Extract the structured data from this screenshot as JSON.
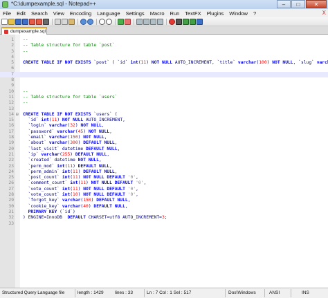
{
  "window": {
    "title": "*C:\\dumpexample.sql - Notepad++",
    "min": "–",
    "max": "□",
    "close": "✕"
  },
  "menu": [
    "File",
    "Edit",
    "Search",
    "View",
    "Encoding",
    "Language",
    "Settings",
    "Macro",
    "Run",
    "TextFX",
    "Plugins",
    "Window",
    "?"
  ],
  "menu_close": "X",
  "tab": {
    "label": "dumpexample.sql"
  },
  "editor": {
    "lines": [
      {
        "n": "1",
        "fold": "",
        "segs": [
          {
            "c": "cmt",
            "t": "--"
          }
        ]
      },
      {
        "n": "2",
        "fold": "",
        "segs": [
          {
            "c": "cmt",
            "t": "-- Table structure for table `post`"
          }
        ]
      },
      {
        "n": "3",
        "fold": "",
        "segs": [
          {
            "c": "cmt",
            "t": "--"
          }
        ]
      },
      {
        "n": "4",
        "fold": "",
        "segs": []
      },
      {
        "n": "5",
        "fold": "",
        "segs": [
          {
            "c": "kw",
            "t": "CREATE TABLE IF NOT EXISTS "
          },
          {
            "c": "tx",
            "t": "`post` ( `id` "
          },
          {
            "c": "kw",
            "t": "int"
          },
          {
            "c": "tx",
            "t": "("
          },
          {
            "c": "num",
            "t": "11"
          },
          {
            "c": "tx",
            "t": ") "
          },
          {
            "c": "kw",
            "t": "NOT NULL"
          },
          {
            "c": "tx",
            "t": " AUTO_INCREMENT, `title` "
          },
          {
            "c": "kw",
            "t": "varchar"
          },
          {
            "c": "tx",
            "t": "("
          },
          {
            "c": "num",
            "t": "100"
          },
          {
            "c": "tx",
            "t": ") "
          },
          {
            "c": "kw",
            "t": "NOT NULL"
          },
          {
            "c": "tx",
            "t": ", `slug` "
          },
          {
            "c": "kw",
            "t": "varchar"
          },
          {
            "c": "tx",
            "t": "("
          },
          {
            "c": "num",
            "t": "2"
          }
        ]
      },
      {
        "n": "6",
        "fold": "",
        "segs": []
      },
      {
        "n": "7",
        "fold": "",
        "segs": [],
        "current": true
      },
      {
        "n": "8",
        "fold": "",
        "segs": []
      },
      {
        "n": "9",
        "fold": "",
        "segs": []
      },
      {
        "n": "10",
        "fold": "",
        "segs": [
          {
            "c": "cmt",
            "t": "--"
          }
        ]
      },
      {
        "n": "11",
        "fold": "",
        "segs": [
          {
            "c": "cmt",
            "t": "-- Table structure for table `users`"
          }
        ]
      },
      {
        "n": "12",
        "fold": "",
        "segs": [
          {
            "c": "cmt",
            "t": "--"
          }
        ]
      },
      {
        "n": "13",
        "fold": "",
        "segs": []
      },
      {
        "n": "14",
        "fold": "⊟",
        "segs": [
          {
            "c": "kw",
            "t": "CREATE TABLE IF NOT EXISTS "
          },
          {
            "c": "tx",
            "t": "`users` ("
          }
        ]
      },
      {
        "n": "15",
        "fold": "",
        "segs": [
          {
            "c": "tx",
            "t": "  `id` "
          },
          {
            "c": "kw",
            "t": "int"
          },
          {
            "c": "tx",
            "t": "("
          },
          {
            "c": "num",
            "t": "11"
          },
          {
            "c": "tx",
            "t": ") "
          },
          {
            "c": "kw",
            "t": "NOT NULL"
          },
          {
            "c": "tx",
            "t": " AUTO_INCREMENT,"
          }
        ]
      },
      {
        "n": "16",
        "fold": "",
        "segs": [
          {
            "c": "tx",
            "t": "  `login` "
          },
          {
            "c": "kw",
            "t": "varchar"
          },
          {
            "c": "tx",
            "t": "("
          },
          {
            "c": "num",
            "t": "32"
          },
          {
            "c": "tx",
            "t": ") "
          },
          {
            "c": "kw",
            "t": "NOT NULL"
          },
          {
            "c": "tx",
            "t": ","
          }
        ]
      },
      {
        "n": "17",
        "fold": "",
        "segs": [
          {
            "c": "tx",
            "t": "  `password` "
          },
          {
            "c": "kw",
            "t": "varchar"
          },
          {
            "c": "tx",
            "t": "("
          },
          {
            "c": "num",
            "t": "45"
          },
          {
            "c": "tx",
            "t": ") "
          },
          {
            "c": "kw",
            "t": "NOT NULL"
          },
          {
            "c": "tx",
            "t": ","
          }
        ]
      },
      {
        "n": "18",
        "fold": "",
        "segs": [
          {
            "c": "tx",
            "t": "  `email` "
          },
          {
            "c": "kw",
            "t": "varchar"
          },
          {
            "c": "tx",
            "t": "("
          },
          {
            "c": "num",
            "t": "150"
          },
          {
            "c": "tx",
            "t": ") "
          },
          {
            "c": "kw",
            "t": "NOT NULL"
          },
          {
            "c": "tx",
            "t": ","
          }
        ]
      },
      {
        "n": "19",
        "fold": "",
        "segs": [
          {
            "c": "tx",
            "t": "  `about` "
          },
          {
            "c": "kw",
            "t": "varchar"
          },
          {
            "c": "tx",
            "t": "("
          },
          {
            "c": "num",
            "t": "300"
          },
          {
            "c": "tx",
            "t": ") "
          },
          {
            "c": "kw",
            "t": "DEFAULT NULL"
          },
          {
            "c": "tx",
            "t": ","
          }
        ]
      },
      {
        "n": "20",
        "fold": "",
        "segs": [
          {
            "c": "tx",
            "t": "  `last_visit` datetime "
          },
          {
            "c": "kw",
            "t": "DEFAULT NULL"
          },
          {
            "c": "tx",
            "t": ","
          }
        ]
      },
      {
        "n": "21",
        "fold": "",
        "segs": [
          {
            "c": "tx",
            "t": "  `ip` "
          },
          {
            "c": "kw",
            "t": "varchar"
          },
          {
            "c": "tx",
            "t": "("
          },
          {
            "c": "num",
            "t": "255"
          },
          {
            "c": "tx",
            "t": ") "
          },
          {
            "c": "kw",
            "t": "DEFAULT NULL"
          },
          {
            "c": "tx",
            "t": ","
          }
        ]
      },
      {
        "n": "22",
        "fold": "",
        "segs": [
          {
            "c": "tx",
            "t": "  `created` datetime "
          },
          {
            "c": "kw",
            "t": "NOT NULL"
          },
          {
            "c": "tx",
            "t": ","
          }
        ]
      },
      {
        "n": "23",
        "fold": "",
        "segs": [
          {
            "c": "tx",
            "t": "  `perm_mod` "
          },
          {
            "c": "kw",
            "t": "int"
          },
          {
            "c": "tx",
            "t": "("
          },
          {
            "c": "num",
            "t": "11"
          },
          {
            "c": "tx",
            "t": ") "
          },
          {
            "c": "kw",
            "t": "DEFAULT NULL"
          },
          {
            "c": "tx",
            "t": ","
          }
        ]
      },
      {
        "n": "24",
        "fold": "",
        "segs": [
          {
            "c": "tx",
            "t": "  `perm_admin` "
          },
          {
            "c": "kw",
            "t": "int"
          },
          {
            "c": "tx",
            "t": "("
          },
          {
            "c": "num",
            "t": "11"
          },
          {
            "c": "tx",
            "t": ") "
          },
          {
            "c": "kw",
            "t": "DEFAULT NULL"
          },
          {
            "c": "tx",
            "t": ","
          }
        ]
      },
      {
        "n": "25",
        "fold": "",
        "segs": [
          {
            "c": "tx",
            "t": "  `post_count` "
          },
          {
            "c": "kw",
            "t": "int"
          },
          {
            "c": "tx",
            "t": "("
          },
          {
            "c": "num",
            "t": "11"
          },
          {
            "c": "tx",
            "t": ") "
          },
          {
            "c": "kw",
            "t": "NOT NULL DEFAULT"
          },
          {
            "c": "str",
            "t": " '0'"
          },
          {
            "c": "tx",
            "t": ","
          }
        ]
      },
      {
        "n": "26",
        "fold": "",
        "segs": [
          {
            "c": "tx",
            "t": "  `comment_count` "
          },
          {
            "c": "kw",
            "t": "int"
          },
          {
            "c": "tx",
            "t": "("
          },
          {
            "c": "num",
            "t": "11"
          },
          {
            "c": "tx",
            "t": ") "
          },
          {
            "c": "kw",
            "t": "NOT NULL DEFAULT"
          },
          {
            "c": "str",
            "t": " '0'"
          },
          {
            "c": "tx",
            "t": ","
          }
        ]
      },
      {
        "n": "27",
        "fold": "",
        "segs": [
          {
            "c": "tx",
            "t": "  `vote_count` "
          },
          {
            "c": "kw",
            "t": "int"
          },
          {
            "c": "tx",
            "t": "("
          },
          {
            "c": "num",
            "t": "11"
          },
          {
            "c": "tx",
            "t": ") "
          },
          {
            "c": "kw",
            "t": "NOT NULL DEFAULT"
          },
          {
            "c": "str",
            "t": " '0'"
          },
          {
            "c": "tx",
            "t": ","
          }
        ]
      },
      {
        "n": "28",
        "fold": "",
        "segs": [
          {
            "c": "tx",
            "t": "  `vote_count` "
          },
          {
            "c": "kw",
            "t": "int"
          },
          {
            "c": "tx",
            "t": "("
          },
          {
            "c": "num",
            "t": "10"
          },
          {
            "c": "tx",
            "t": ") "
          },
          {
            "c": "kw",
            "t": "NOT NULL DEFAULT"
          },
          {
            "c": "str",
            "t": " '0'"
          },
          {
            "c": "tx",
            "t": ","
          }
        ]
      },
      {
        "n": "29",
        "fold": "",
        "segs": [
          {
            "c": "tx",
            "t": "  `forgot_key` "
          },
          {
            "c": "kw",
            "t": "varchar"
          },
          {
            "c": "tx",
            "t": "("
          },
          {
            "c": "num",
            "t": "150"
          },
          {
            "c": "tx",
            "t": ") "
          },
          {
            "c": "kw",
            "t": "DEFAULT NULL"
          },
          {
            "c": "tx",
            "t": ","
          }
        ]
      },
      {
        "n": "30",
        "fold": "",
        "segs": [
          {
            "c": "tx",
            "t": "  `cookie_key` "
          },
          {
            "c": "kw",
            "t": "varchar"
          },
          {
            "c": "tx",
            "t": "("
          },
          {
            "c": "num",
            "t": "40"
          },
          {
            "c": "tx",
            "t": ") "
          },
          {
            "c": "kw",
            "t": "DEFAULT NULL"
          },
          {
            "c": "tx",
            "t": ","
          }
        ]
      },
      {
        "n": "31",
        "fold": "",
        "segs": [
          {
            "c": "kw",
            "t": "  PRIMARY KEY"
          },
          {
            "c": "tx",
            "t": " (`id`)"
          }
        ]
      },
      {
        "n": "32",
        "fold": "",
        "segs": [
          {
            "c": "tx",
            "t": ") ENGINE=InnoDB  "
          },
          {
            "c": "kw",
            "t": "DEFAULT"
          },
          {
            "c": "tx",
            "t": " CHARSET=utf8 AUTO_INCREMENT="
          },
          {
            "c": "num",
            "t": "3"
          },
          {
            "c": "tx",
            "t": ";"
          }
        ]
      },
      {
        "n": "33",
        "fold": "",
        "segs": []
      }
    ]
  },
  "status": {
    "lang": "Structured Query Language file",
    "length": "length : 1429",
    "lines": "lines : 33",
    "pos": "Ln : 7    Col : 1    Sel : 517",
    "eol": "Dos\\Windows",
    "enc": "ANSI",
    "mode": "INS"
  },
  "colors": {
    "comment": "#008000",
    "keyword": "#0000ff",
    "number": "#ff0000",
    "text": "#000080",
    "current_line": "#e8e8ff",
    "tab_accent": "#f39c12"
  }
}
